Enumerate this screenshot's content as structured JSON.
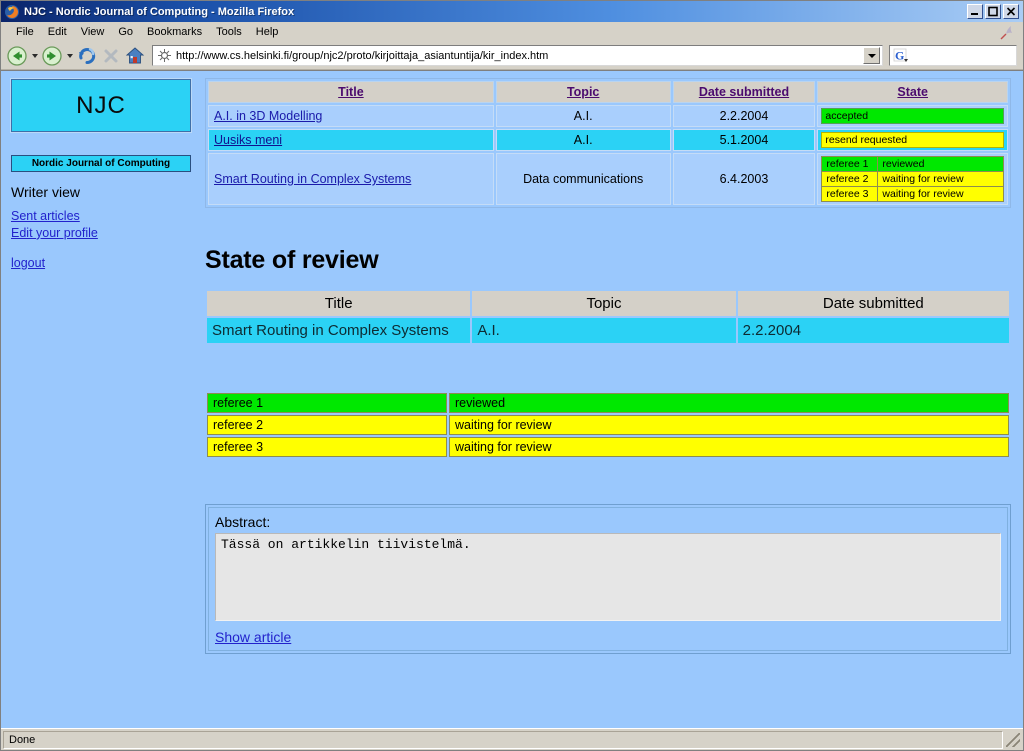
{
  "window": {
    "title": "NJC - Nordic Journal of Computing - Mozilla Firefox",
    "minimize_label": "_",
    "maximize_label": "□",
    "close_label": "✕"
  },
  "menubar": {
    "items": [
      {
        "label": "File"
      },
      {
        "label": "Edit"
      },
      {
        "label": "View"
      },
      {
        "label": "Go"
      },
      {
        "label": "Bookmarks"
      },
      {
        "label": "Tools"
      },
      {
        "label": "Help"
      }
    ]
  },
  "toolbar": {
    "url": "http://www.cs.helsinki.fi/group/njc2/proto/kirjoittaja_asiantuntija/kir_index.htm",
    "search_placeholder": ""
  },
  "sidebar": {
    "logo_text": "NJC",
    "journal_button": "Nordic Journal of Computing",
    "view_label": "Writer view",
    "links": [
      {
        "label": "Sent articles"
      },
      {
        "label": "Edit your profile"
      }
    ],
    "logout": "logout"
  },
  "articles_table": {
    "headers": [
      "Title",
      "Topic",
      "Date submitted",
      "State"
    ],
    "rows": [
      {
        "title": "A.I. in 3D Modelling",
        "topic": "A.I.",
        "date": "2.2.2004",
        "highlighted": false,
        "state_type": "single",
        "state_label": "accepted",
        "state_color": "green"
      },
      {
        "title": "Uusiks meni",
        "topic": "A.I.",
        "date": "5.1.2004",
        "highlighted": true,
        "state_type": "single",
        "state_label": "resend requested",
        "state_color": "yellow"
      },
      {
        "title": "Smart Routing in Complex Systems",
        "topic": "Data communications",
        "date": "6.4.2003",
        "highlighted": false,
        "state_type": "referees",
        "referees": [
          {
            "name": "referee 1",
            "status": "reviewed",
            "color": "green"
          },
          {
            "name": "referee 2",
            "status": "waiting for review",
            "color": "yellow"
          },
          {
            "name": "referee 3",
            "status": "waiting for review",
            "color": "yellow"
          }
        ]
      }
    ]
  },
  "state_of_review": {
    "heading": "State of review",
    "headers": [
      "Title",
      "Topic",
      "Date submitted"
    ],
    "row": {
      "title": "Smart Routing in Complex Systems",
      "topic": "A.I.",
      "date": "2.2.2004"
    },
    "referees": [
      {
        "name": "referee 1",
        "status": "reviewed",
        "color": "green"
      },
      {
        "name": "referee 2",
        "status": "waiting for review",
        "color": "yellow"
      },
      {
        "name": "referee 3",
        "status": "waiting for review",
        "color": "yellow"
      }
    ]
  },
  "abstract": {
    "label": "Abstract:",
    "text": "Tässä on artikkelin tiivistelmä.",
    "show_article_link": "Show article"
  },
  "statusbar": {
    "text": "Done"
  },
  "colors": {
    "page_background": "#9ac8fd",
    "accent_cyan": "#2bd2f5",
    "header_gray": "#d4d0c8",
    "status_green": "#00e800",
    "status_yellow": "#ffff00",
    "link": "#2222cc"
  }
}
